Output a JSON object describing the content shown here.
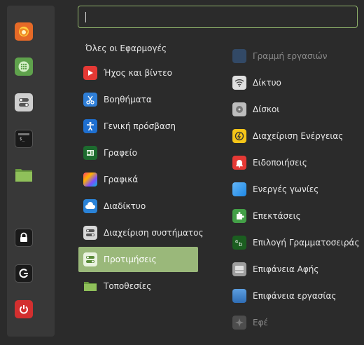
{
  "search": {
    "value": "",
    "placeholder": ""
  },
  "favorites": [
    {
      "icon": "firefox-icon",
      "color": "#e66a27"
    },
    {
      "icon": "software-manager-icon",
      "color": "#5fa24c"
    },
    {
      "icon": "settings-toggles-icon",
      "color": "#bdbdbd"
    },
    {
      "icon": "terminal-icon",
      "color": "#1e1e1e"
    },
    {
      "icon": "folder-icon",
      "color": "#7fb24f"
    },
    {
      "icon": "lock-icon",
      "color": "#1e1e1e"
    },
    {
      "icon": "logout-icon",
      "color": "#1e1e1e"
    },
    {
      "icon": "power-icon",
      "color": "#d32f2f"
    }
  ],
  "categories": {
    "all_label": "Όλες οι Εφαρμογές",
    "items": [
      {
        "label": "Ήχος και βίντεο",
        "icon": "play-icon"
      },
      {
        "label": "Βοηθήματα",
        "icon": "scissors-icon"
      },
      {
        "label": "Γενική πρόσβαση",
        "icon": "accessibility-icon"
      },
      {
        "label": "Γραφείο",
        "icon": "office-icon"
      },
      {
        "label": "Γραφικά",
        "icon": "graphics-icon"
      },
      {
        "label": "Διαδίκτυο",
        "icon": "cloud-icon"
      },
      {
        "label": "Διαχείριση συστήματος",
        "icon": "system-toggles-icon"
      },
      {
        "label": "Προτιμήσεις",
        "icon": "preferences-toggles-icon",
        "selected": true
      },
      {
        "label": "Τοποθεσίες",
        "icon": "folder-icon"
      }
    ]
  },
  "apps": [
    {
      "label": "Γραμμή εργασιών",
      "icon": "panel-icon",
      "dim": true
    },
    {
      "label": "Δίκτυο",
      "icon": "wifi-icon"
    },
    {
      "label": "Δίσκοι",
      "icon": "disk-icon"
    },
    {
      "label": "Διαχείριση Ενέργειας",
      "icon": "power-management-icon"
    },
    {
      "label": "Ειδοποιήσεις",
      "icon": "bell-icon"
    },
    {
      "label": "Ενεργές γωνίες",
      "icon": "hot-corners-icon"
    },
    {
      "label": "Επεκτάσεις",
      "icon": "puzzle-icon"
    },
    {
      "label": "Επιλογή Γραμματοσειράς",
      "icon": "font-icon"
    },
    {
      "label": "Επιφάνεια Αφής",
      "icon": "touchpad-icon"
    },
    {
      "label": "Επιφάνεια εργασίας",
      "icon": "desktop-icon"
    },
    {
      "label": "Εφέ",
      "icon": "effects-icon",
      "dim": true
    }
  ]
}
